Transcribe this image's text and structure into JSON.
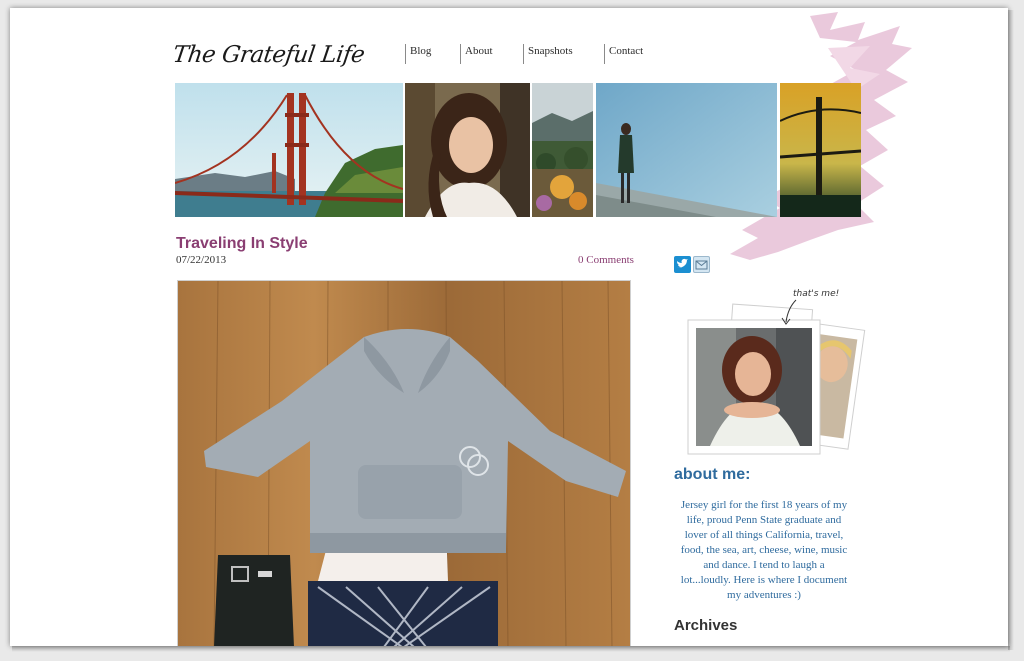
{
  "site": {
    "logo": "The Grateful Life"
  },
  "nav": {
    "items": [
      "Blog",
      "About",
      "Snapshots",
      "Contact"
    ]
  },
  "post": {
    "title": "Traveling In Style",
    "date": "07/22/2013",
    "comments": "0 Comments"
  },
  "sidebar": {
    "social": [
      "twitter-icon",
      "mail-icon"
    ],
    "photo_caption": "that's me!",
    "about_heading": "about me:",
    "about_text": "Jersey girl for the first 18 years of my life, proud Penn State graduate and lover of all things California, travel, food, the sea, art, cheese, wine, music and dance.  I tend to laugh a lot...loudly. Here is where I document my adventures :)",
    "archives_heading": "Archives"
  },
  "colors": {
    "accent_purple": "#8a3e72",
    "accent_blue": "#2f6b9e",
    "brush_pink": "#e8c3d8"
  }
}
